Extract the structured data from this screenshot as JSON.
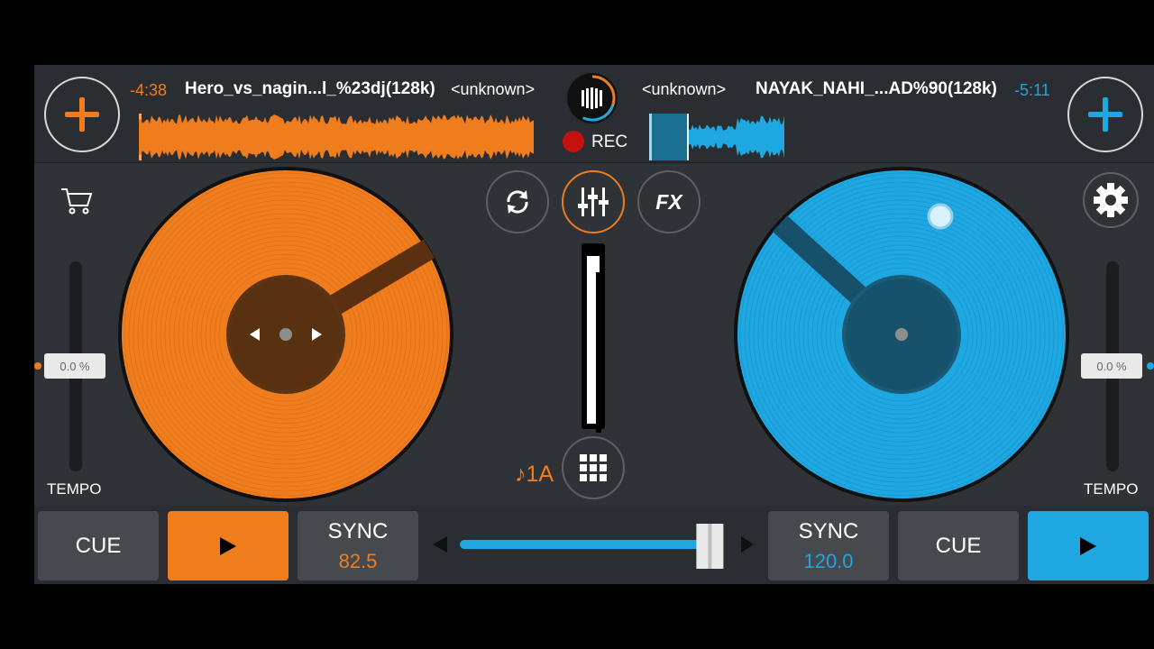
{
  "deck_a": {
    "time": "-4:38",
    "title": "Hero_vs_nagin...l_%23dj(128k)",
    "artist": "<unknown>",
    "tempo": "0.0 %",
    "tempo_label": "TEMPO",
    "cue_label": "CUE",
    "sync_label": "SYNC",
    "bpm": "82.5",
    "key": "♪1A",
    "color": "#f07d1d"
  },
  "deck_b": {
    "time": "-5:11",
    "title": "NAYAK_NAHI_...AD%90(128k)",
    "artist": "<unknown>",
    "tempo": "0.0 %",
    "tempo_label": "TEMPO",
    "cue_label": "CUE",
    "sync_label": "SYNC",
    "bpm": "120.0",
    "color": "#1ea7e1"
  },
  "recorder": {
    "label": "REC"
  },
  "mixer": {
    "fx_label": "FX",
    "crossfader": 0.95
  },
  "icons": [
    "plus-icon",
    "cart-icon",
    "loop-icon",
    "mixer-icon",
    "fx-icon",
    "gear-icon",
    "grid-icon",
    "play-icon",
    "record-icon"
  ]
}
